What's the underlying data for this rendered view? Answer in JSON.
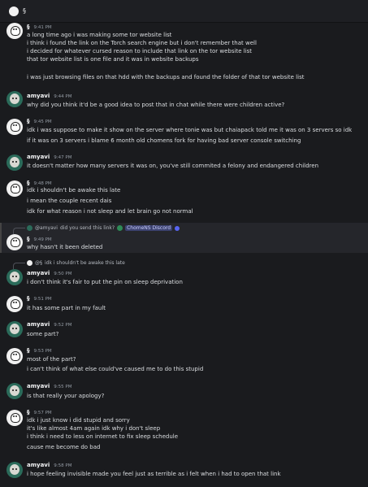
{
  "header": {
    "channel_name": "§"
  },
  "messages": [
    {
      "author": "§",
      "time": "9:41 PM",
      "lines": [
        "a long time ago i was making some tor website list",
        "i think i found the link on the Torch search engine but i don't remember that well",
        "i decided for whatever cursed reason to include that link on the tor website list",
        "that tor website list is one file and it was in website backups",
        "",
        "i was just browsing files on that hdd with the backups and found the folder of that tor website list"
      ]
    },
    {
      "author": "amyavi",
      "time": "9:44 PM",
      "lines": [
        "why did you think it'd be a good idea to post that in chat while there were children active?"
      ]
    },
    {
      "author": "§",
      "time": "9:45 PM",
      "lines": [
        "idk i was suppose to make it show on the server where tonie was but chaiapack told me it was on 3 servers so idk",
        "if it was on 3 servers i blame 6 month old chomens fork for having bad server console switching"
      ]
    },
    {
      "author": "amyavi",
      "time": "9:47 PM",
      "lines": [
        "it doesn't matter how many servers it was on, you've still commited a felony and endangered children"
      ]
    },
    {
      "author": "§",
      "time": "9:48 PM",
      "lines": [
        "idk i shouldn't be awake this late",
        "i mean the couple recent dais",
        "idk for what reason i not sleep and let brain go not normal"
      ]
    },
    {
      "reply": {
        "mention": "@amyavi",
        "text": "did you send this link?",
        "link": "ChomeNS Discord"
      },
      "author": "§",
      "time": "9:49 PM",
      "lines": [
        "why hasn't it been deleted"
      ]
    },
    {
      "reply": {
        "mention": "@§",
        "text": "idk i shouldn't be awake this late"
      },
      "author": "amyavi",
      "time": "9:50 PM",
      "lines": [
        "i don't think it's fair to put the pin on sleep deprivation"
      ]
    },
    {
      "author": "§",
      "time": "9:51 PM",
      "lines": [
        "it has some part in my fault"
      ]
    },
    {
      "author": "amyavi",
      "time": "9:52 PM",
      "lines": [
        "some part?"
      ]
    },
    {
      "author": "§",
      "time": "9:53 PM",
      "lines": [
        "most of the part?",
        "i can't think of what else could've caused me to do this stupid"
      ]
    },
    {
      "author": "amyavi",
      "time": "9:55 PM",
      "lines": [
        "is that really your apology?"
      ]
    },
    {
      "author": "§",
      "time": "9:57 PM",
      "lines": [
        "idk i just know i did stupid and sorry",
        "it's like almost 4am again idk why i don't sleep",
        "i think i need to less on internet to fix sleep schedule",
        "cause me become do bad"
      ]
    },
    {
      "author": "amyavi",
      "time": "9:58 PM",
      "lines": [
        "i hope feeling invisible made you feel just as terrible as i felt when i had to open that link"
      ]
    }
  ]
}
